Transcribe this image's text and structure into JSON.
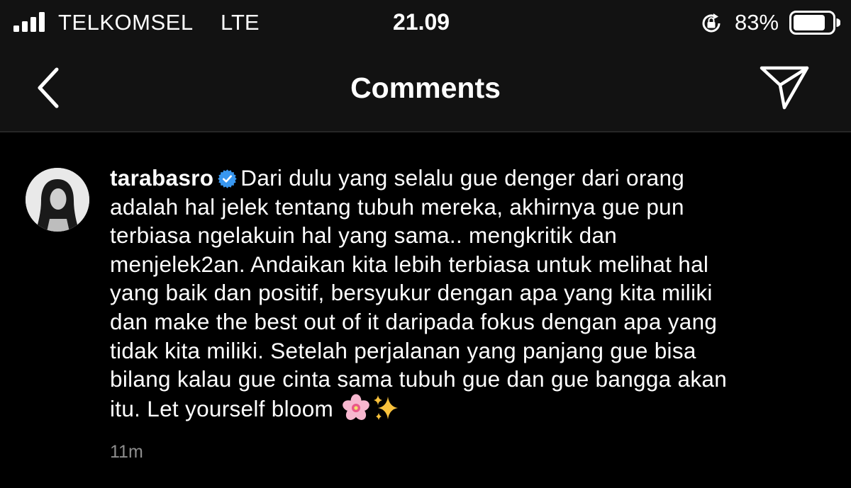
{
  "status_bar": {
    "carrier": "TELKOMSEL",
    "network": "LTE",
    "time": "21.09",
    "battery_percent": "83%",
    "battery_level": 0.83,
    "icons": [
      "signal-bars-icon",
      "orientation-lock-icon",
      "battery-icon"
    ]
  },
  "header": {
    "title": "Comments",
    "icons": [
      "back-chevron-icon",
      "direct-share-icon"
    ]
  },
  "comment": {
    "username": "tarabasro",
    "verified": true,
    "text_lines": [
      "Dari dulu yang selalu gue denger dari orang",
      "adalah hal jelek tentang tubuh mereka, akhirnya gue pun",
      "terbiasa ngelakuin hal yang sama.. mengkritik dan",
      "menjelek2an. Andaikan kita lebih terbiasa untuk melihat hal",
      "yang baik dan positif, bersyukur dengan apa yang kita miliki",
      "dan make the best out of it daripada fokus dengan apa yang",
      "tidak kita miliki. Setelah perjalanan yang panjang gue bisa",
      "bilang kalau gue cinta sama tubuh gue dan gue bangga akan",
      "itu. Let yourself bloom"
    ],
    "emojis": [
      "cherry-blossom-emoji",
      "sparkles-emoji"
    ],
    "timestamp": "11m"
  },
  "colors": {
    "background": "#000000",
    "bar_background": "#121212",
    "text": "#ffffff",
    "muted_text": "#8e8e8e",
    "verified_badge": "#3897f0",
    "divider": "#262626"
  }
}
